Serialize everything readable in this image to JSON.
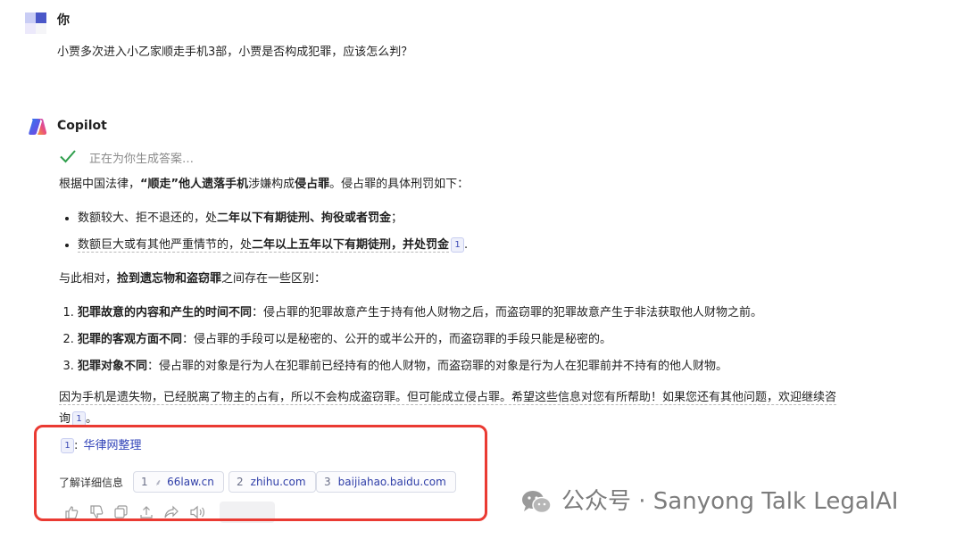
{
  "user": {
    "name": "你",
    "message": "小贾多次进入小乙家顺走手机3部，小贾是否构成犯罪，应该怎么判？"
  },
  "copilot": {
    "name": "Copilot",
    "status": "正在为你生成答案…"
  },
  "answer": {
    "p1": [
      "根据中国法律，",
      "“顺走”他人遗落手机",
      "涉嫌构成",
      "侵占罪",
      "。侵占罪的具体刑罚如下："
    ],
    "bullets": [
      [
        "数额较大、拒不退还的，处",
        "二年以下有期徒刑、拘役或者罚金",
        "；"
      ],
      [
        "数额巨大或有其他严重情节的，处",
        "二年以上五年以下有期徒刑，并处罚金",
        "1",
        "."
      ]
    ],
    "p2": [
      "与此相对，",
      "捡到遗忘物和盗窃罪",
      "之间存在一些区别："
    ],
    "items": [
      [
        "犯罪故意的内容和产生的时间不同",
        "：侵占罪的犯罪故意产生于持有他人财物之后，而盗窃罪的犯罪故意产生于非法获取他人财物之前。"
      ],
      [
        "犯罪的客观方面不同",
        "：侵占罪的手段可以是秘密的、公开的或半公开的，而盗窃罪的手段只能是秘密的。"
      ],
      [
        "犯罪对象不同",
        "：侵占罪的对象是行为人在犯罪前已经持有的他人财物，而盗窃罪的对象是行为人在犯罪前并不持有的他人财物。"
      ]
    ],
    "p3a": "因为手机是遗失物，已经脱离了物主的占有，所以不会构成盗窃罪。但可能成立侵占罪。希望这些信息对您有所帮助！如果您还有其他问题，欢迎继续咨",
    "p3b": "询",
    "p3c": "1",
    "p3d": "。"
  },
  "reference": {
    "num": "1",
    "sep": ":",
    "title": "华律网整理"
  },
  "learn_more": {
    "label": "了解详细信息",
    "sources": [
      {
        "num": "1",
        "domain": "66law.cn"
      },
      {
        "num": "2",
        "domain": "zhihu.com"
      },
      {
        "num": "3",
        "domain": "baijiahao.baidu.com"
      }
    ]
  },
  "watermark": "公众号 · Sanyong Talk LegalAI",
  "colors": {
    "accent": "#3345b9",
    "highlight_box": "#ea3a32",
    "check": "#2e9e4b"
  }
}
